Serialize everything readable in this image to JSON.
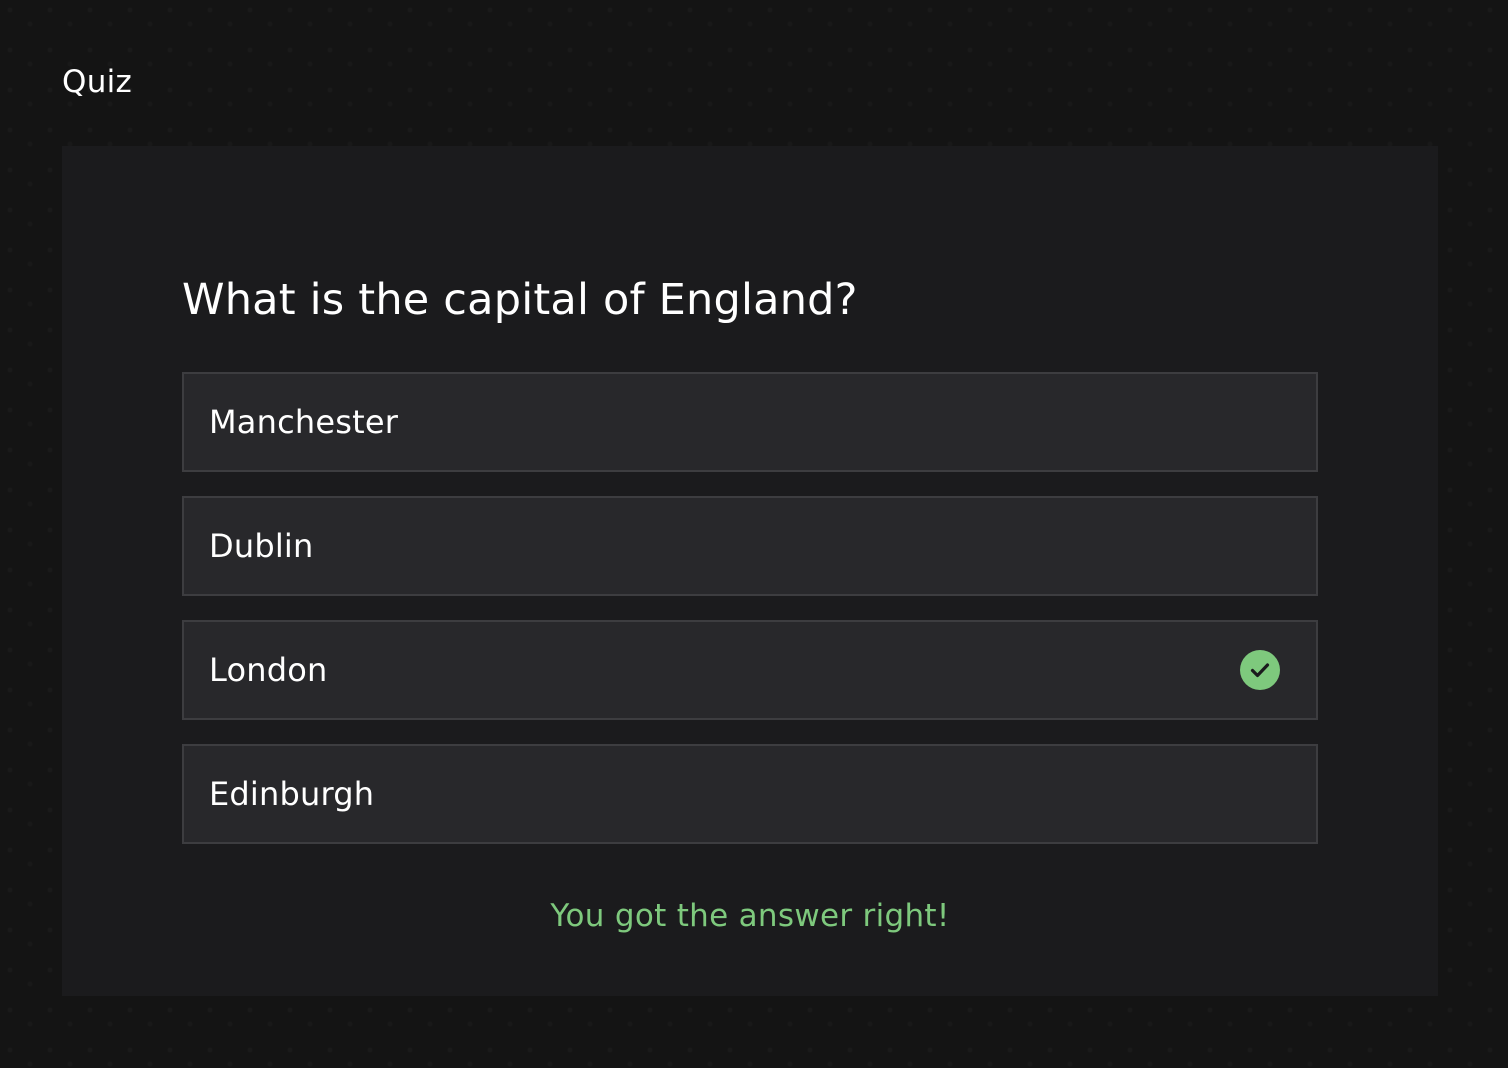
{
  "app": {
    "title": "Quiz"
  },
  "quiz": {
    "question": "What is the capital of England?",
    "options": [
      {
        "label": "Manchester",
        "correct": false
      },
      {
        "label": "Dublin",
        "correct": false
      },
      {
        "label": "London",
        "correct": true,
        "status_icon": "check-circle-icon"
      },
      {
        "label": "Edinburgh",
        "correct": false
      }
    ],
    "result_message": "You got the answer right!"
  },
  "colors": {
    "page_background": "#141414",
    "card_background": "#1b1b1d",
    "option_background": "#28282b",
    "option_border": "#3d3d40",
    "success": "#7ec97d",
    "text": "#ffffff"
  }
}
